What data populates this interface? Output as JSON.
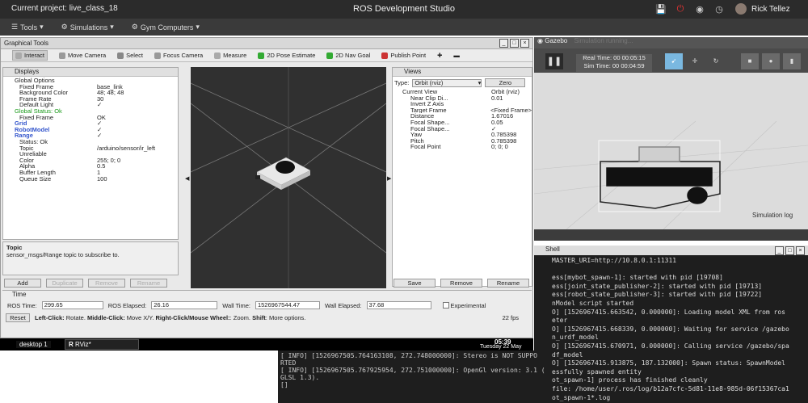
{
  "topbar": {
    "project": "Current project: live_class_18",
    "title": "ROS Development Studio",
    "user": "Rick Tellez"
  },
  "menubar": {
    "items": [
      {
        "label": "Tools"
      },
      {
        "label": "Simulations"
      },
      {
        "label": "Gym Computers"
      }
    ]
  },
  "rviz": {
    "window_title": "Graphical Tools",
    "toolbar": [
      "Interact",
      "Move Camera",
      "Select",
      "Focus Camera",
      "Measure",
      "2D Pose Estimate",
      "2D Nav Goal",
      "Publish Point"
    ],
    "displays_title": "Displays",
    "displays": [
      {
        "k": "Global Options",
        "v": ""
      },
      {
        "k": "Fixed Frame",
        "v": "base_link"
      },
      {
        "k": "Background Color",
        "v": "48; 48; 48"
      },
      {
        "k": "Frame Rate",
        "v": "30"
      },
      {
        "k": "Default Light",
        "v": "✓"
      },
      {
        "k": "Global Status: Ok",
        "v": ""
      },
      {
        "k": "Fixed Frame",
        "v": "OK"
      },
      {
        "k": "Grid",
        "v": "✓"
      },
      {
        "k": "RobotModel",
        "v": "✓"
      },
      {
        "k": "Range",
        "v": "✓"
      },
      {
        "k": "Status: Ok",
        "v": ""
      },
      {
        "k": "Topic",
        "v": "/arduino/sensor/ir_left"
      },
      {
        "k": "Unreliable",
        "v": ""
      },
      {
        "k": "Color",
        "v": "255; 0; 0"
      },
      {
        "k": "Alpha",
        "v": "0.5"
      },
      {
        "k": "Buffer Length",
        "v": "1"
      },
      {
        "k": "Queue Size",
        "v": "100"
      }
    ],
    "topic_title": "Topic",
    "topic_desc": "sensor_msgs/Range topic to subscribe to.",
    "display_buttons": [
      "Add",
      "Duplicate",
      "Remove",
      "Rename"
    ],
    "views_title": "Views",
    "views_type_label": "Type:",
    "views_type_value": "Orbit (rviz)",
    "views_zero": "Zero",
    "views": [
      {
        "k": "Current View",
        "v": "Orbit (rviz)"
      },
      {
        "k": "Near Clip Di...",
        "v": "0.01"
      },
      {
        "k": "Invert Z Axis",
        "v": ""
      },
      {
        "k": "Target Frame",
        "v": "<Fixed Frame>"
      },
      {
        "k": "Distance",
        "v": "1.67016"
      },
      {
        "k": "Focal Shape...",
        "v": "0.05"
      },
      {
        "k": "Focal Shape...",
        "v": "✓"
      },
      {
        "k": "Yaw",
        "v": "0.785398"
      },
      {
        "k": "Pitch",
        "v": "0.785398"
      },
      {
        "k": "Focal Point",
        "v": "0; 0; 0"
      }
    ],
    "views_buttons": [
      "Save",
      "Remove",
      "Rename"
    ],
    "time_title": "Time",
    "ros_time_label": "ROS Time:",
    "ros_time": "299.65",
    "ros_elapsed_label": "ROS Elapsed:",
    "ros_elapsed": "26.16",
    "wall_time_label": "Wall Time:",
    "wall_time": "1526967544.47",
    "wall_elapsed_label": "Wall Elapsed:",
    "wall_elapsed": "37.68",
    "experimental": "Experimental",
    "reset": "Reset",
    "hint_bold1": "Left-Click:",
    "hint1": " Rotate. ",
    "hint_bold2": "Middle-Click:",
    "hint2": " Move X/Y. ",
    "hint_bold3": "Right-Click/Mouse Wheel:",
    "hint3": ": Zoom. ",
    "hint_bold4": "Shift",
    "hint4": ": More options.",
    "fps": "22 fps"
  },
  "taskbar": {
    "desktop": "desktop 1",
    "app": "RViz*",
    "time": "05:39",
    "date": "Tuesday 22 May"
  },
  "gazebo": {
    "title": "Gazebo",
    "subtitle": "Simulation running...",
    "real_time": "Real Time: 00 00:05:15",
    "sim_time": "Sim Time: 00 00:04:59",
    "sim_log": "Simulation log"
  },
  "shell": {
    "title": "Shell",
    "lines": [
      "MASTER_URI=http://10.8.0.1:11311",
      "",
      "ess[mybot_spawn-1]: started with pid [19708]",
      "ess[joint_state_publisher-2]: started with pid [19713]",
      "ess[robot_state_publisher-3]: started with pid [19722]",
      "nModel script started",
      "O] [1526967415.663542, 0.000000]: Loading model XML from ros",
      "eter",
      "O] [1526967415.668339, 0.000000]: Waiting for service /gazebo",
      "n_urdf_model",
      "O] [1526967415.670971, 0.000000]: Calling service /gazebo/spa",
      "df_model",
      "O] [1526967415.913875, 187.132000]: Spawn status: SpawnModel",
      "essfully spawned entity",
      "ot_spawn-1] process has finished cleanly",
      "file: /home/user/.ros/log/b12a7cfc-5d81-11e8-985d-06f15367ca1",
      "ot_spawn-1*.log"
    ]
  },
  "term2": {
    "lines": [
      "[ INFO] [1526967505.764163108, 272.748000000]: Stereo is NOT SUPPO",
      "RTED",
      "[ INFO] [1526967505.767925954, 272.751000000]: OpenGl version: 3.1 (",
      "GLSL 1.3).",
      "[]"
    ]
  },
  "colors": {
    "topbar": "#2b2b2b",
    "gazebo_bg": "#3c3c3c",
    "rviz_grid_bg": "#303030",
    "accent_red": "#d62020"
  }
}
